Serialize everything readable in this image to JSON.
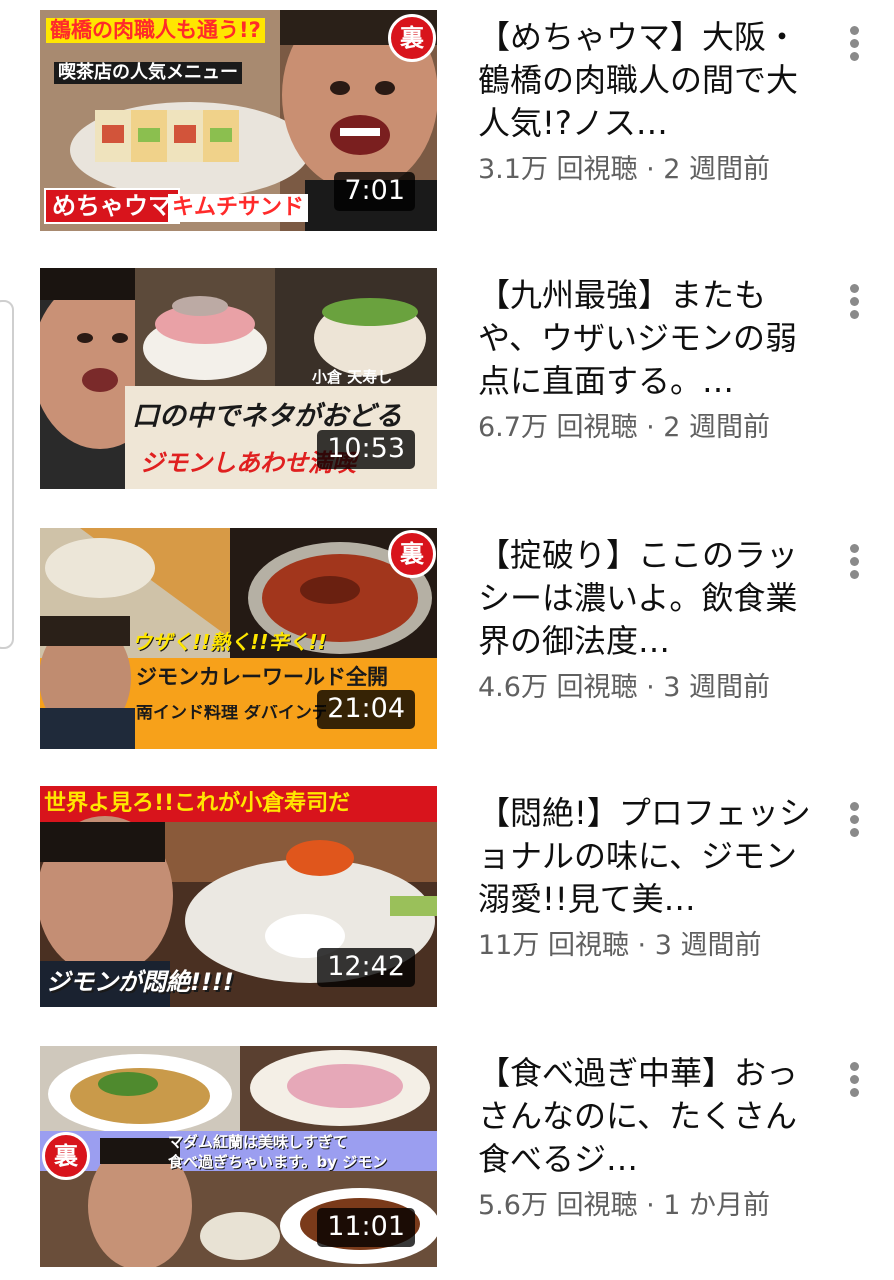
{
  "videos": [
    {
      "title": "【めちゃウマ】大阪・鶴橋の肉職人の間で大人気!?ノス…",
      "views": "3.1万 回視聴",
      "age": "2 週間前",
      "duration": "7:01",
      "thumb_texts": [
        "鶴橋の肉職人も通う!?",
        "喫茶店の人気メニュー",
        "めちゃウマ",
        "キムチサンド"
      ],
      "badge": "裏"
    },
    {
      "title": "【九州最強】またもや、ウザいジモンの弱点に直面する。…",
      "views": "6.7万 回視聴",
      "age": "2 週間前",
      "duration": "10:53",
      "thumb_texts": [
        "小倉 天寿し",
        "口の中でネタがおどる",
        "ジモンしあわせ満喫"
      ]
    },
    {
      "title": "【掟破り】ここのラッシーは濃いよ。飲食業界の御法度…",
      "views": "4.6万 回視聴",
      "age": "3 週間前",
      "duration": "21:04",
      "thumb_texts": [
        "ウザく!!熱く!!辛く!!",
        "ジモンカレーワールド全開",
        "南インド料理 ダバインディア"
      ],
      "badge": "裏"
    },
    {
      "title": "【悶絶!】プロフェッショナルの味に、ジモン溺愛!!見て美…",
      "views": "11万 回視聴",
      "age": "3 週間前",
      "duration": "12:42",
      "thumb_texts": [
        "世界よ見ろ!!これが小倉寿司だ",
        "ジモンが悶絶!!!!"
      ]
    },
    {
      "title": "【食べ過ぎ中華】おっさんなのに、たくさん食べるジ…",
      "views": "5.6万 回視聴",
      "age": "1 か月前",
      "duration": "11:01",
      "thumb_texts": [
        "マダム紅蘭は美味しすぎて",
        "食べ過ぎちゃいます。by ジモン"
      ],
      "badge": "裏"
    }
  ],
  "separator": " · ",
  "icons": {
    "menu": "more-vert-icon",
    "badge": "ura-badge-icon"
  },
  "colors": {
    "title": "#0f0f0f",
    "meta": "#606060",
    "duration_bg": "#000000",
    "badge_red": "#d8141c",
    "caption_yellow": "#ffe600",
    "caption_orange": "#f7a11a"
  }
}
